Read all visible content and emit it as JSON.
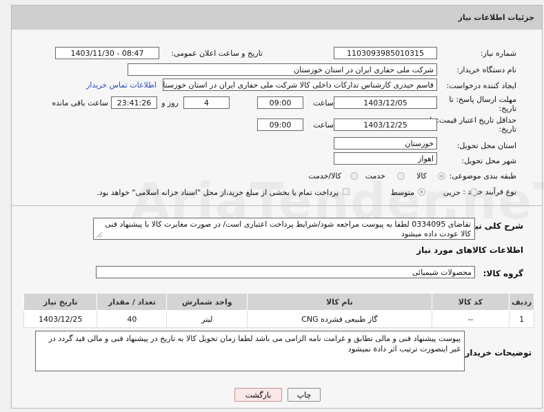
{
  "header": {
    "title": "جزئیات اطلاعات نیاز"
  },
  "fields": {
    "need_number_label": "شماره نیاز:",
    "need_number": "1103093985010315",
    "announce_label": "تاریخ و ساعت اعلان عمومی:",
    "announce_value": "1403/11/30 - 08:47",
    "buyer_label": "نام دستگاه خریدار:",
    "buyer_value": "شرکت ملی حفاری ایران در استان خوزستان",
    "creator_label": "ایجاد کننده درخواست:",
    "creator_value": "قاسم حیدری کارشناس تدارکات داخلی کالا شرکت ملی حفاری ایران در استان خوزستان",
    "contact_link": "اطلاعات تماس خریدار",
    "deadline_label_1": "مهلت ارسال پاسخ: تا",
    "deadline_label_2": "تاریخ:",
    "deadline_date": "1403/12/05",
    "time_label": "ساعت",
    "deadline_time": "09:00",
    "days_value": "4",
    "days_label": "روز و",
    "remaining_time": "23:41:26",
    "remaining_label": "ساعت باقی مانده",
    "validity_label_1": "حداقل تاریخ اعتبار قیمت: تا",
    "validity_label_2": "تاریخ:",
    "validity_date": "1403/12/25",
    "validity_time": "09:00",
    "province_label": "استان محل تحویل:",
    "province_value": "خوزستان",
    "city_label": "شهر محل تحویل:",
    "city_value": "اهواز",
    "category_label": "طبقه بندی موضوعی:",
    "category_options": [
      "کالا",
      "خدمت",
      "کالا/خدمت"
    ],
    "purchase_label": "نوع فرآیند خرید :",
    "purchase_options": [
      "جزیی",
      "متوسط"
    ],
    "payment_text": "پرداخت تمام یا بخشی از مبلغ خرید،از محل \"اسناد خزانه اسلامی\" خواهد بود."
  },
  "description": {
    "label": "شرح کلی نیاز:",
    "text": "تقاضای 0334095 لطفا به پیوست مراجعه شود/شرایط پرداخت اعتباری است/ در صورت مغایرت کالا با پیشنهاد فنی کالا عودت داده میشود"
  },
  "goods": {
    "section_title": "اطلاعات کالاهای مورد نیاز",
    "group_label": "گروه کالا:",
    "group_value": "محصولات شیمیائی",
    "columns": [
      "ردیف",
      "کد کالا",
      "نام کالا",
      "واحد شمارش",
      "تعداد / مقدار",
      "تاریخ نیاز"
    ],
    "rows": [
      [
        "1",
        "--",
        "گاز طبیعی فشرده CNG",
        "لیتر",
        "40",
        "1403/12/25"
      ]
    ]
  },
  "buyer_notes": {
    "label": "توضیحات خریدار:",
    "text": "پیوست پیشنهاد فنی و مالی تطابق و غرامت نامه الزامی می باشد لطفا زمان تحویل کالا به تاریخ در پیشنهاد فنی و مالی قید گردد در غیر اینصورت ترتیب اثر دادة نمیشود"
  },
  "buttons": {
    "print": "چاپ",
    "back": "بازگشت"
  },
  "watermark": "AriaTender.neT"
}
